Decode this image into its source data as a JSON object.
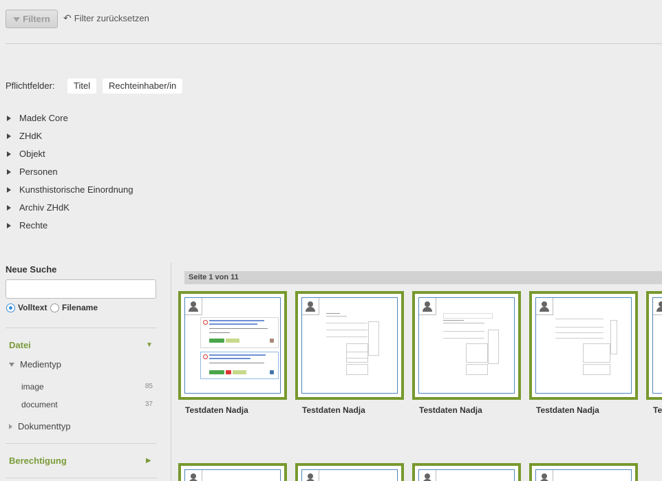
{
  "toolbar": {
    "filter_label": "Filtern",
    "reset_label": "Filter zurücksetzen"
  },
  "required": {
    "label": "Pflichtfelder:",
    "tags": [
      "Titel",
      "Rechteinhaber/in"
    ]
  },
  "meta_keys": [
    "Madek Core",
    "ZHdK",
    "Objekt",
    "Personen",
    "Kunsthistorische Einordnung",
    "Archiv ZHdK",
    "Rechte"
  ],
  "sidebar": {
    "title": "Neue Suche",
    "search_value": "",
    "radio_fulltext": "Volltext",
    "radio_filename": "Filename",
    "section_file": "Datei",
    "sub_mediatype": "Medientyp",
    "facets": [
      {
        "label": "image",
        "count": "85"
      },
      {
        "label": "document",
        "count": "37"
      }
    ],
    "sub_doctype": "Dokumenttyp",
    "section_permission": "Berechtigung"
  },
  "results": {
    "page_label": "Seite 1 von 11",
    "items": [
      {
        "title": "Testdaten Nadja"
      },
      {
        "title": "Testdaten Nadja"
      },
      {
        "title": "Testdaten Nadja"
      },
      {
        "title": "Testdaten Nadja"
      },
      {
        "title": "Testdaten Nadja"
      }
    ]
  },
  "colors": {
    "accent_green": "#77992e",
    "radio_blue": "#3b8fd9",
    "background": "#ededed"
  },
  "icons": [
    "filter-icon",
    "undo-icon",
    "user-icon"
  ]
}
